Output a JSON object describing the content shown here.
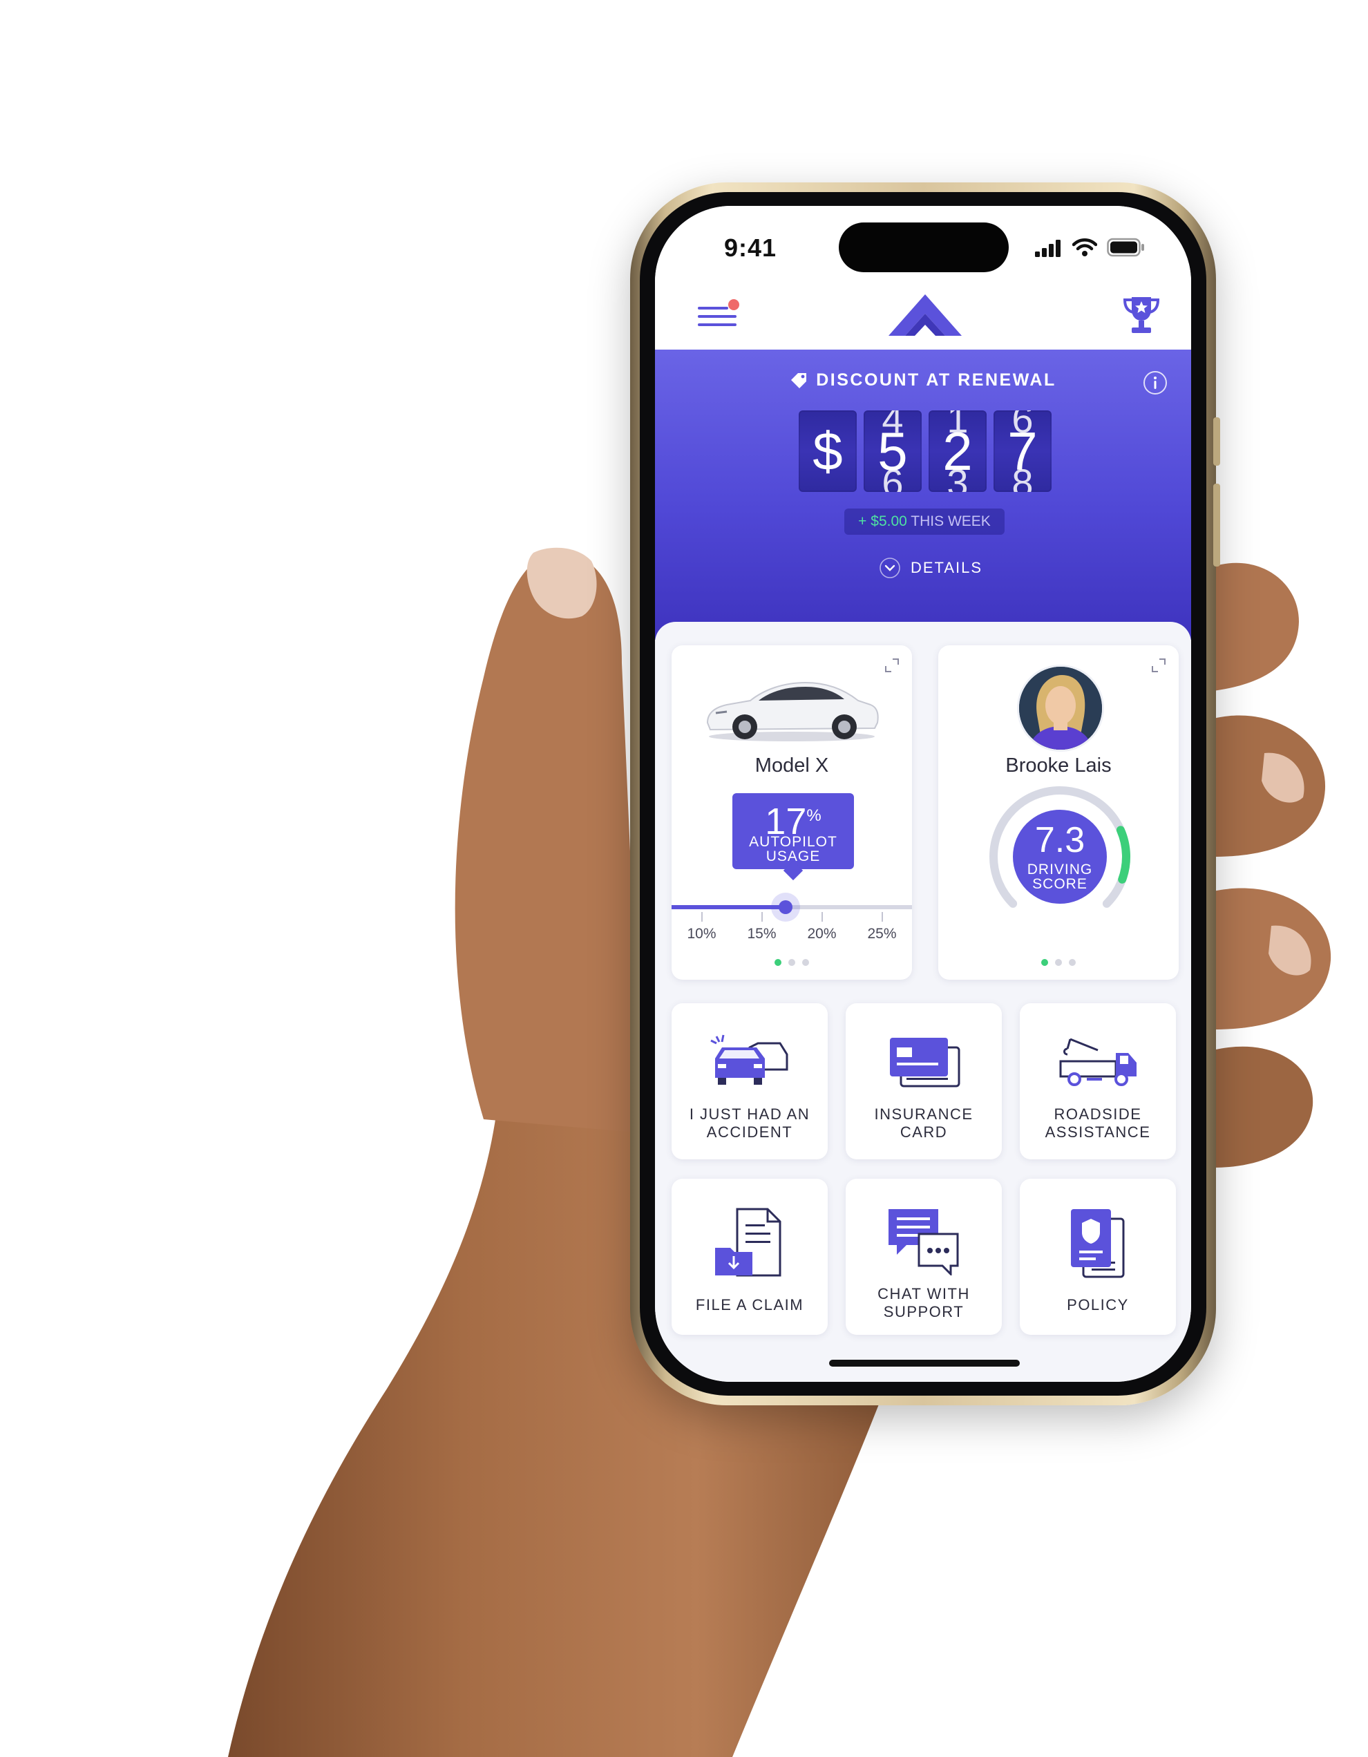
{
  "status_bar": {
    "time": "9:41"
  },
  "app_header": {
    "menu_icon": "menu-icon",
    "logo_icon": "logo-icon",
    "trophy_icon": "trophy-icon"
  },
  "discount": {
    "title": "DISCOUNT AT RENEWAL",
    "currency": "$",
    "digits": [
      "5",
      "2",
      "7"
    ],
    "weekly_change": "+ $5.00",
    "weekly_period": "THIS WEEK",
    "details_label": "DETAILS"
  },
  "vehicle_card": {
    "name": "Model X",
    "autopilot_value": "17",
    "autopilot_unit": "%",
    "autopilot_caption_1": "AUTOPILOT",
    "autopilot_caption_2": "USAGE",
    "slider_ticks": [
      "10%",
      "15%",
      "20%",
      "25%"
    ],
    "slider_value_percent": 17,
    "slider_min_percent": 7.5,
    "slider_max_percent": 27.5,
    "active_page": 0,
    "page_count": 3
  },
  "driver_card": {
    "name": "Brooke Lais",
    "score": "7.3",
    "score_caption_1": "DRIVING",
    "score_caption_2": "SCORE",
    "score_fraction": 0.73,
    "active_page": 0,
    "page_count": 3
  },
  "actions": [
    {
      "id": "accident",
      "line1": "I JUST HAD AN",
      "line2": "ACCIDENT",
      "icon": "car-crash-icon"
    },
    {
      "id": "insurance",
      "line1": "INSURANCE",
      "line2": "CARD",
      "icon": "insurance-card-icon"
    },
    {
      "id": "roadside",
      "line1": "ROADSIDE",
      "line2": "ASSISTANCE",
      "icon": "tow-truck-icon"
    },
    {
      "id": "claim",
      "line1": "FILE A CLAIM",
      "line2": "",
      "icon": "file-claim-icon"
    },
    {
      "id": "chat",
      "line1": "CHAT WITH",
      "line2": "SUPPORT",
      "icon": "chat-icon"
    },
    {
      "id": "policy",
      "line1": "POLICY",
      "line2": "",
      "icon": "policy-icon"
    }
  ],
  "colors": {
    "brand": "#5b52db",
    "hero_top": "#6a64e6",
    "hero_bottom": "#3e33be",
    "positive": "#4fe2a1",
    "score_ring": "#3ccf7a"
  }
}
